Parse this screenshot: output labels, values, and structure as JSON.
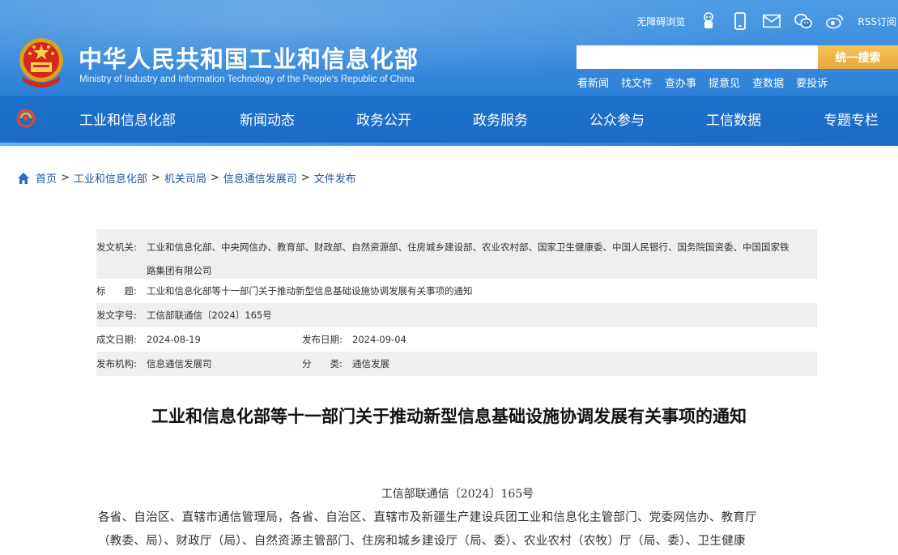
{
  "header": {
    "title": "中华人民共和国工业和信息化部",
    "subtitle": "Ministry of Industry and Information Technology of the People's Republic of China",
    "accessibility_label": "无障碍浏览",
    "rss_label": "RSS订阅",
    "top_icons": [
      "robot-icon",
      "mobile-icon",
      "mail-icon",
      "wechat-icon",
      "weibo-icon"
    ],
    "search": {
      "placeholder": "",
      "button_label": "统一搜索"
    },
    "quick_links": [
      "看新闻",
      "找文件",
      "查办事",
      "提意见",
      "查数据",
      "要投诉"
    ],
    "nav": [
      "工业和信息化部",
      "新闻动态",
      "政务公开",
      "政务服务",
      "公众参与",
      "工信数据",
      "专题专栏"
    ],
    "colors": {
      "header_blue": "#2c80d6",
      "search_button": "#e8a83a"
    }
  },
  "breadcrumb": [
    "首页",
    "工业和信息化部",
    "机关司局",
    "信息通信发展司",
    "文件发布"
  ],
  "meta": {
    "issuer_label": "发文机关:",
    "issuer_line1": "工业和信息化部、中央网信办、教育部、财政部、自然资源部、住房城乡建设部、农业农村部、国家卫生健康委、中国人民银行、国务院国资委、中国国家铁",
    "issuer_line2": "路集团有限公司",
    "title_label": "标　　题:",
    "title_value": "工业和信息化部等十一部门关于推动新型信息基础设施协调发展有关事项的通知",
    "docno_label": "发文字号:",
    "docno_value": "工信部联通信〔2024〕165号",
    "created_label": "成文日期:",
    "created_value": "2024-08-19",
    "published_label": "发布日期:",
    "published_value": "2024-09-04",
    "org_label": "发布机构:",
    "org_value": "信息通信发展司",
    "category_label": "分　　类:",
    "category_value": "通信发展"
  },
  "article": {
    "title": "工业和信息化部等十一部门关于推动新型信息基础设施协调发展有关事项的通知",
    "doc_no": "工信部联通信〔2024〕165号",
    "line1": "各省、自治区、直辖市通信管理局，各省、自治区、直辖市及新疆生产建设兵团工业和信息化主管部门、党委网信办、教育厅",
    "line2": "（教委、局）、财政厅（局）、自然资源主管部门、住房和城乡建设厅（局、委）、农业农村（农牧）厅（局、委）、卫生健康"
  }
}
